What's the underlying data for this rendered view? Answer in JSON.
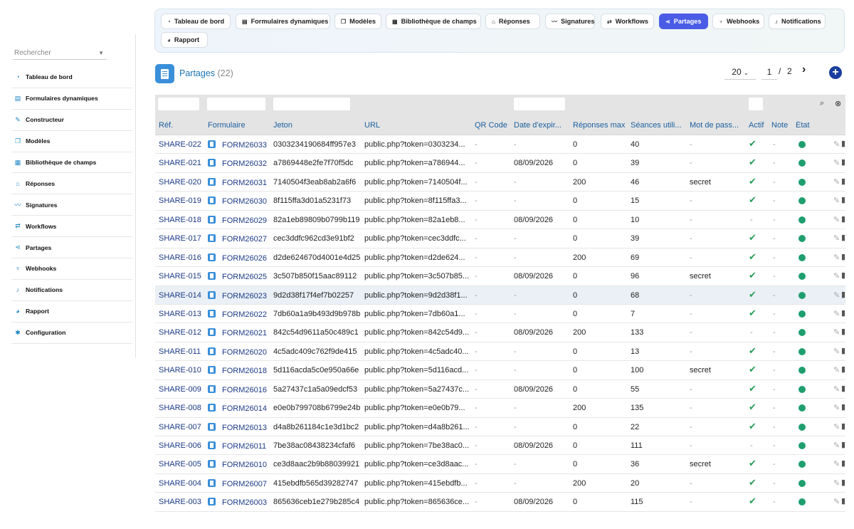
{
  "sidebar": {
    "search_placeholder": "Rechercher",
    "items": [
      {
        "label": "Tableau de bord",
        "icon": "dashboard-icon"
      },
      {
        "label": "Formulaires dynamiques",
        "icon": "forms-icon"
      },
      {
        "label": "Constructeur",
        "icon": "builder-icon"
      },
      {
        "label": "Modèles",
        "icon": "templates-icon"
      },
      {
        "label": "Bibliothèque de champs",
        "icon": "fields-library-icon"
      },
      {
        "label": "Réponses",
        "icon": "responses-icon"
      },
      {
        "label": "Signatures",
        "icon": "signature-icon"
      },
      {
        "label": "Workflows",
        "icon": "workflow-icon"
      },
      {
        "label": "Partages",
        "icon": "share-icon"
      },
      {
        "label": "Webhooks",
        "icon": "webhook-icon"
      },
      {
        "label": "Notifications",
        "icon": "bell-icon"
      },
      {
        "label": "Rapport",
        "icon": "report-icon"
      },
      {
        "label": "Configuration",
        "icon": "gear-icon"
      }
    ]
  },
  "tabs": [
    {
      "label": "Tableau de bord",
      "active": false
    },
    {
      "label": "Formulaires dynamiques",
      "active": false
    },
    {
      "label": "Modèles",
      "active": false
    },
    {
      "label": "Bibliothèque de champs",
      "active": false
    },
    {
      "label": "Réponses",
      "active": false
    },
    {
      "label": "Signatures",
      "active": false
    },
    {
      "label": "Workflows",
      "active": false
    },
    {
      "label": "Partages",
      "active": true
    },
    {
      "label": "Webhooks",
      "active": false
    },
    {
      "label": "Notifications",
      "active": false
    },
    {
      "label": "Rapport",
      "active": false
    }
  ],
  "header": {
    "title": "Partages",
    "count": "(22)",
    "per_page": "20",
    "page": "1",
    "page_sep": "/",
    "total_pages": "2",
    "next": "›",
    "add": "+"
  },
  "columns": [
    "Réf.",
    "Formulaire",
    "Jeton",
    "URL",
    "QR Code",
    "Date d'expir...",
    "Réponses max",
    "Séances utili...",
    "Mot de pass...",
    "Actif",
    "Note",
    "État"
  ],
  "rows": [
    {
      "ref": "SHARE-022",
      "form": "FORM26033",
      "token": "0303234190684ff957e3",
      "url": "public.php?token=0303234...",
      "qr": "-",
      "exp": "-",
      "max": "0",
      "used": "40",
      "pwd": "-",
      "active": true,
      "note": "-"
    },
    {
      "ref": "SHARE-021",
      "form": "FORM26032",
      "token": "a7869448e2fe7f70f5dc",
      "url": "public.php?token=a786944...",
      "qr": "-",
      "exp": "08/09/2026",
      "max": "0",
      "used": "39",
      "pwd": "-",
      "active": true,
      "note": "-"
    },
    {
      "ref": "SHARE-020",
      "form": "FORM26031",
      "token": "7140504f3eab8ab2a6f6",
      "url": "public.php?token=7140504f...",
      "qr": "-",
      "exp": "-",
      "max": "200",
      "used": "46",
      "pwd": "secret",
      "active": true,
      "note": "-"
    },
    {
      "ref": "SHARE-019",
      "form": "FORM26030",
      "token": "8f115ffa3d01a5231f73",
      "url": "public.php?token=8f115ffa3...",
      "qr": "-",
      "exp": "-",
      "max": "0",
      "used": "15",
      "pwd": "-",
      "active": true,
      "note": "-"
    },
    {
      "ref": "SHARE-018",
      "form": "FORM26029",
      "token": "82a1eb89809b0799b119",
      "url": "public.php?token=82a1eb8...",
      "qr": "-",
      "exp": "08/09/2026",
      "max": "0",
      "used": "10",
      "pwd": "-",
      "active": false,
      "note": "-"
    },
    {
      "ref": "SHARE-017",
      "form": "FORM26027",
      "token": "cec3ddfc962cd3e91bf2",
      "url": "public.php?token=cec3ddfc...",
      "qr": "-",
      "exp": "-",
      "max": "0",
      "used": "39",
      "pwd": "-",
      "active": true,
      "note": "-"
    },
    {
      "ref": "SHARE-016",
      "form": "FORM26026",
      "token": "d2de624670d4001e4d25",
      "url": "public.php?token=d2de624...",
      "qr": "-",
      "exp": "-",
      "max": "200",
      "used": "69",
      "pwd": "-",
      "active": true,
      "note": "-"
    },
    {
      "ref": "SHARE-015",
      "form": "FORM26025",
      "token": "3c507b850f15aac89112",
      "url": "public.php?token=3c507b85...",
      "qr": "-",
      "exp": "08/09/2026",
      "max": "0",
      "used": "96",
      "pwd": "secret",
      "active": true,
      "note": "-"
    },
    {
      "ref": "SHARE-014",
      "form": "FORM26023",
      "token": "9d2d38f17f4ef7b02257",
      "url": "public.php?token=9d2d38f1...",
      "qr": "-",
      "exp": "-",
      "max": "0",
      "used": "68",
      "pwd": "-",
      "active": true,
      "note": "-"
    },
    {
      "ref": "SHARE-013",
      "form": "FORM26022",
      "token": "7db60a1a9b493d9b978b",
      "url": "public.php?token=7db60a1...",
      "qr": "-",
      "exp": "-",
      "max": "0",
      "used": "7",
      "pwd": "-",
      "active": true,
      "note": "-"
    },
    {
      "ref": "SHARE-012",
      "form": "FORM26021",
      "token": "842c54d9611a50c489c1",
      "url": "public.php?token=842c54d9...",
      "qr": "-",
      "exp": "08/09/2026",
      "max": "200",
      "used": "133",
      "pwd": "-",
      "active": false,
      "note": "-"
    },
    {
      "ref": "SHARE-011",
      "form": "FORM26020",
      "token": "4c5adc409c762f9de415",
      "url": "public.php?token=4c5adc40...",
      "qr": "-",
      "exp": "-",
      "max": "0",
      "used": "13",
      "pwd": "-",
      "active": true,
      "note": "-"
    },
    {
      "ref": "SHARE-010",
      "form": "FORM26018",
      "token": "5d116acda5c0e950a66e",
      "url": "public.php?token=5d116acd...",
      "qr": "-",
      "exp": "-",
      "max": "0",
      "used": "100",
      "pwd": "secret",
      "active": true,
      "note": "-"
    },
    {
      "ref": "SHARE-009",
      "form": "FORM26016",
      "token": "5a27437c1a5a09edcf53",
      "url": "public.php?token=5a27437c...",
      "qr": "-",
      "exp": "08/09/2026",
      "max": "0",
      "used": "55",
      "pwd": "-",
      "active": true,
      "note": "-"
    },
    {
      "ref": "SHARE-008",
      "form": "FORM26014",
      "token": "e0e0b799708b6799e24b",
      "url": "public.php?token=e0e0b79...",
      "qr": "-",
      "exp": "-",
      "max": "200",
      "used": "135",
      "pwd": "-",
      "active": true,
      "note": "-"
    },
    {
      "ref": "SHARE-007",
      "form": "FORM26013",
      "token": "d4a8b261184c1e3d1bc2",
      "url": "public.php?token=d4a8b261...",
      "qr": "-",
      "exp": "-",
      "max": "0",
      "used": "22",
      "pwd": "-",
      "active": true,
      "note": "-"
    },
    {
      "ref": "SHARE-006",
      "form": "FORM26011",
      "token": "7be38ac08438234cfaf6",
      "url": "public.php?token=7be38ac0...",
      "qr": "-",
      "exp": "08/09/2026",
      "max": "0",
      "used": "111",
      "pwd": "-",
      "active": false,
      "note": "-"
    },
    {
      "ref": "SHARE-005",
      "form": "FORM26010",
      "token": "ce3d8aac2b9b88039921",
      "url": "public.php?token=ce3d8aac...",
      "qr": "-",
      "exp": "-",
      "max": "0",
      "used": "36",
      "pwd": "secret",
      "active": true,
      "note": "-"
    },
    {
      "ref": "SHARE-004",
      "form": "FORM26007",
      "token": "415ebdfb565d39282747",
      "url": "public.php?token=415ebdfb...",
      "qr": "-",
      "exp": "-",
      "max": "200",
      "used": "20",
      "pwd": "-",
      "active": true,
      "note": "-"
    },
    {
      "ref": "SHARE-003",
      "form": "FORM26003",
      "token": "865636ceb1e279b285c4",
      "url": "public.php?token=865636ce...",
      "qr": "-",
      "exp": "08/09/2026",
      "max": "0",
      "used": "115",
      "pwd": "-",
      "active": true,
      "note": "-"
    }
  ],
  "highlighted_row": "SHARE-014",
  "icons": {
    "check": "✔",
    "edit": "✎",
    "trash": "🗑",
    "search": "⌕"
  },
  "colors": {
    "accent": "#4a5ce6",
    "link": "#1b3a86",
    "active": "#2a9d5a",
    "status": "#1f9e6e"
  }
}
